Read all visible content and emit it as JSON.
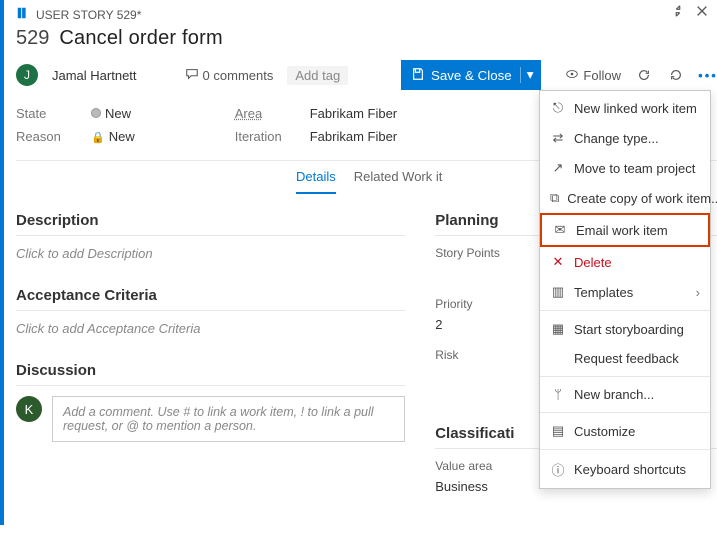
{
  "breadcrumb": {
    "text": "USER STORY 529*"
  },
  "title": {
    "id": "529",
    "text": "Cancel order form"
  },
  "user": {
    "name": "Jamal Hartnett",
    "initial": "J"
  },
  "comments": {
    "count": "0 comments"
  },
  "add_tag": "Add tag",
  "save_btn": "Save & Close",
  "follow": "Follow",
  "fields": {
    "state_label": "State",
    "state_value": "New",
    "reason_label": "Reason",
    "reason_value": "New",
    "area_label": "Area",
    "area_value": "Fabrikam Fiber",
    "iter_label": "Iteration",
    "iter_value": "Fabrikam Fiber"
  },
  "tabs": {
    "details": "Details",
    "related": "Related Work it"
  },
  "sections": {
    "description": {
      "title": "Description",
      "placeholder": "Click to add Description"
    },
    "acceptance": {
      "title": "Acceptance Criteria",
      "placeholder": "Click to add Acceptance Criteria"
    },
    "discussion": {
      "title": "Discussion",
      "placeholder": "Add a comment. Use # to link a work item, ! to link a pull request, or @ to mention a person."
    },
    "planning": {
      "title": "Planning",
      "story_points_label": "Story Points",
      "priority_label": "Priority",
      "priority_value": "2",
      "risk_label": "Risk"
    },
    "classification": {
      "title": "Classificati",
      "value_area_label": "Value area",
      "value_area_value": "Business"
    }
  },
  "menu": {
    "new_linked": "New linked work item",
    "change_type": "Change type...",
    "move_team": "Move to team project",
    "create_copy": "Create copy of work item...",
    "email": "Email work item",
    "delete": "Delete",
    "templates": "Templates",
    "storyboard": "Start storyboarding",
    "feedback": "Request feedback",
    "new_branch": "New branch...",
    "customize": "Customize",
    "shortcuts": "Keyboard shortcuts"
  },
  "discussion_user_initial": "K"
}
